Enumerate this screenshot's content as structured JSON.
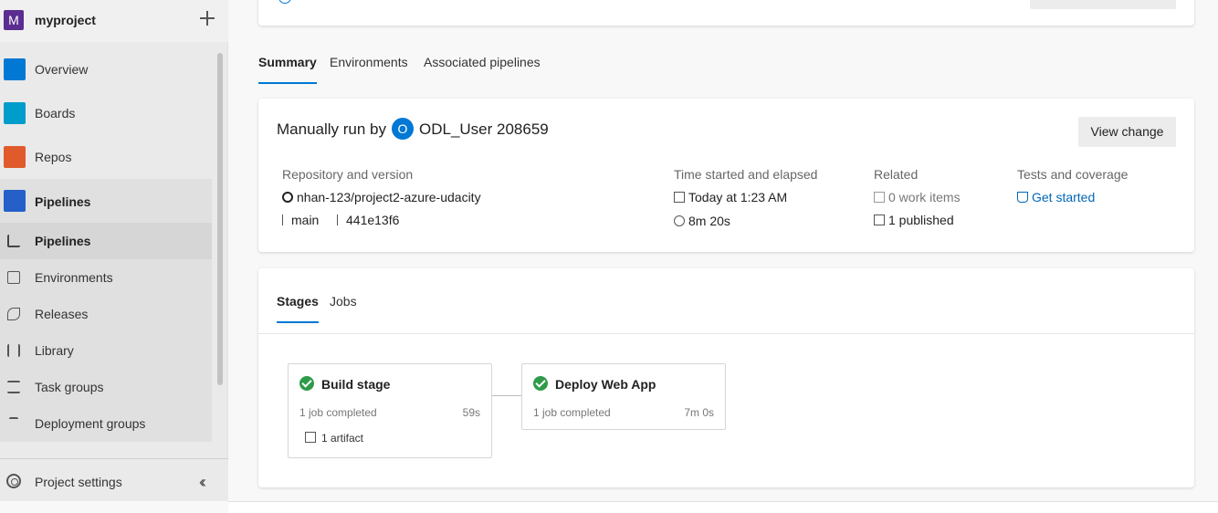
{
  "project": {
    "initial": "M",
    "name": "myproject"
  },
  "nav": {
    "overview": "Overview",
    "boards": "Boards",
    "repos": "Repos",
    "pipelines_group": "Pipelines",
    "pipelines": "Pipelines",
    "environments": "Environments",
    "releases": "Releases",
    "library": "Library",
    "task_groups": "Task groups",
    "deployment_groups": "Deployment groups",
    "project_settings": "Project settings"
  },
  "tabs": [
    "Summary",
    "Environments",
    "Associated pipelines"
  ],
  "summary": {
    "run_by": "Manually run by",
    "user_initial": "O",
    "user_name": "ODL_User 208659",
    "view_change": "View change",
    "repo_header": "Repository and version",
    "repo": "nhan-123/project2-azure-udacity",
    "branch": "main",
    "commit": "441e13f6",
    "time_header": "Time started and elapsed",
    "started": "Today at 1:23 AM",
    "elapsed": "8m 20s",
    "related_header": "Related",
    "work_items": "0 work items",
    "published": "1 published",
    "tests_header": "Tests and coverage",
    "get_started": "Get started"
  },
  "stages_tabs": [
    "Stages",
    "Jobs"
  ],
  "stages": [
    {
      "name": "Build stage",
      "status": "1 job completed",
      "duration": "59s",
      "artifact": "1 artifact"
    },
    {
      "name": "Deploy Web App",
      "status": "1 job completed",
      "duration": "7m 0s"
    }
  ],
  "colors": {
    "accent": "#0078d4",
    "success": "#2e9b49",
    "project": "#5c2d91"
  }
}
